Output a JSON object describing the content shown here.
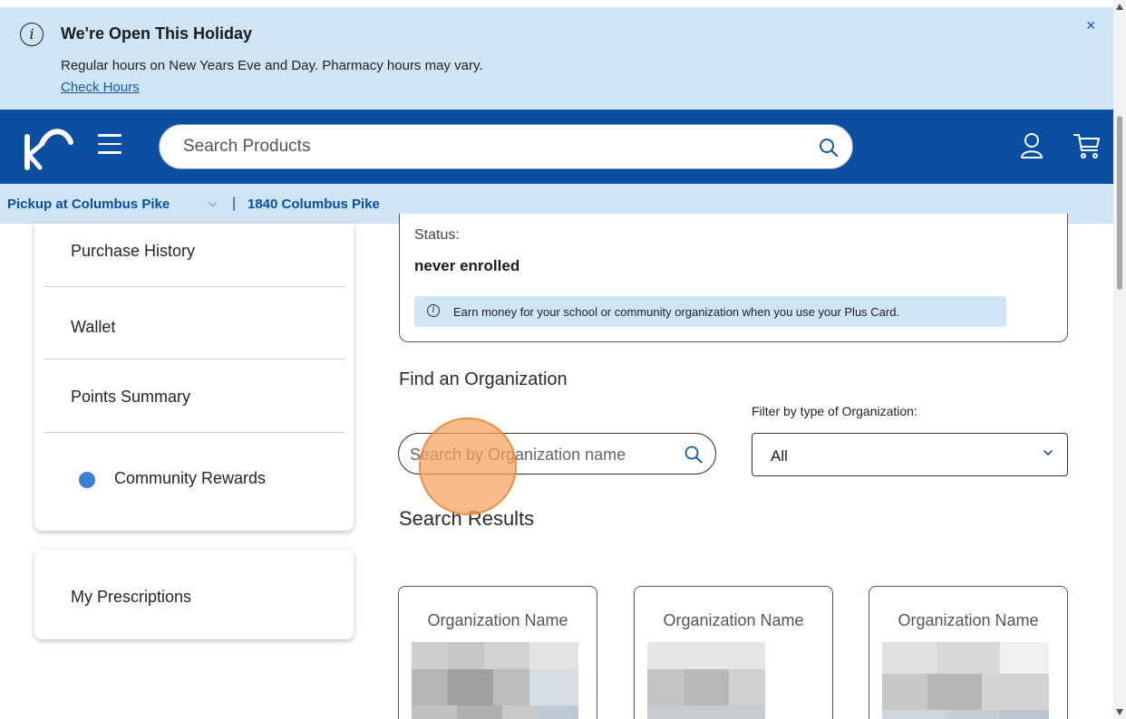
{
  "alert": {
    "title": "We're Open This Holiday",
    "body": "Regular hours on New Years Eve and Day. Pharmacy hours may vary.",
    "link": "Check Hours",
    "close": "×"
  },
  "header": {
    "search_placeholder": "Search Products",
    "icons": [
      "kroger-logo",
      "hamburger-menu-icon",
      "search-icon",
      "account-icon",
      "cart-icon"
    ]
  },
  "pickup": {
    "store": "Pickup at Columbus Pike",
    "chevron": "⌵",
    "separator": "|",
    "address": "1840 Columbus Pike"
  },
  "sidebar": {
    "items": [
      {
        "label": "Purchase History"
      },
      {
        "label": "Wallet"
      },
      {
        "label": "Points Summary"
      },
      {
        "label": "Community Rewards",
        "active": true
      }
    ],
    "prescriptions": "My Prescriptions"
  },
  "status": {
    "label": "Status:",
    "value": "never enrolled",
    "note": "Earn money for your school or community organization when you use your Plus Card."
  },
  "find": {
    "title": "Find an Organization",
    "search_placeholder": "Search by Organization name",
    "filter_label": "Filter by type of Organization:",
    "filter_value": "All"
  },
  "results": {
    "title": "Search Results",
    "cards": [
      {
        "name": "Organization Name"
      },
      {
        "name": "Organization Name"
      },
      {
        "name": "Organization Name"
      }
    ]
  },
  "colors": {
    "brand_blue": "#0a4fa1",
    "banner_blue": "#cfe4f4",
    "active_dot": "#3b82d6",
    "click_marker": "#f5a05a"
  }
}
